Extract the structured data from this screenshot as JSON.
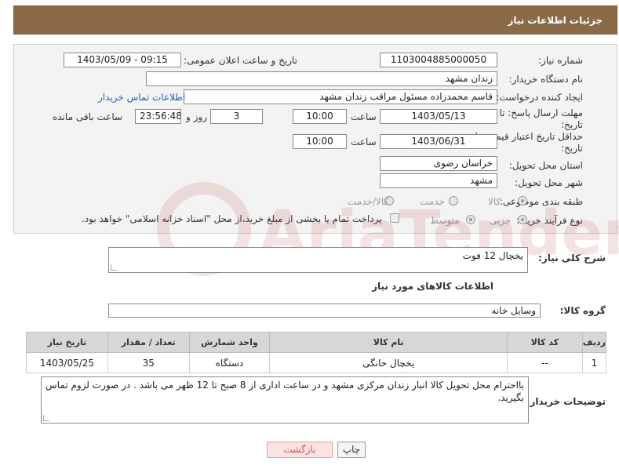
{
  "header": {
    "title": "جزئیات اطلاعات نیاز"
  },
  "form": {
    "need_number": {
      "label": "شماره نیاز:",
      "value": "1103004885000050"
    },
    "announce": {
      "label": "تاریخ و ساعت اعلان عمومی:",
      "value": "1403/05/09 - 09:15"
    },
    "buyer": {
      "label": "نام دستگاه خریدار:",
      "value": "زندان مشهد"
    },
    "creator": {
      "label": "ایجاد کننده درخواست:",
      "value": "قاسم محمدزاده مسئول مراقب زندان مشهد",
      "contact_link": "اطلاعات تماس خریدار"
    },
    "reply_deadline": {
      "label_line1": "مهلت ارسال پاسخ: تا",
      "label_line2": "تاریخ:",
      "date": "1403/05/13",
      "time_label": "ساعت",
      "time": "10:00",
      "days": "3",
      "days_label": "روز و",
      "remaining": "23:56:48",
      "remaining_label": "ساعت باقی مانده"
    },
    "price_deadline": {
      "label_line1": "حداقل تاریخ اعتبار قیمت: تا",
      "label_line2": "تاریخ:",
      "date": "1403/06/31",
      "time_label": "ساعت",
      "time": "10:00"
    },
    "province": {
      "label": "استان محل تحویل:",
      "value": "خراسان رضوی"
    },
    "city": {
      "label": "شهر محل تحویل:",
      "value": "مشهد"
    },
    "category": {
      "label": "طبقه بندی موضوعی:",
      "options": [
        "کالا",
        "خدمت",
        "کالا/خدمت"
      ],
      "selected": "کالا"
    },
    "process": {
      "label": "نوع فرآیند خرید :",
      "options": [
        "جزیی",
        "متوسط"
      ],
      "selected": "جزیی",
      "checkbox_text": "پرداخت تمام یا بخشی از مبلغ خرید،از محل \"اسناد خزانه اسلامی\" خواهد بود."
    }
  },
  "description": {
    "label": "شرح کلی نیاز:",
    "value": "یخچال 12 فوت"
  },
  "goods_section": {
    "title": "اطلاعات کالاهای مورد نیاز"
  },
  "goods_group": {
    "label": "گروه کالا:",
    "value": "وسایل خانه"
  },
  "table": {
    "headers": [
      "ردیف",
      "کد کالا",
      "نام کالا",
      "واحد شمارش",
      "تعداد / مقدار",
      "تاریخ نیاز"
    ],
    "rows": [
      [
        "1",
        "--",
        "یخچال خانگی",
        "دستگاه",
        "35",
        "1403/05/25"
      ]
    ]
  },
  "buyer_notes": {
    "label": "توضیحات خریدار:",
    "value": "بااحترام محل تحویل کالا انبار زندان مرکزی مشهد و در ساعت اداری از 8 صبح تا 12 ظهر می باشد . در صورت لزوم تماس بگیرید."
  },
  "buttons": {
    "print": "چاپ",
    "back": "بازگشت"
  },
  "watermark": {
    "text": "AriaTender.neT"
  }
}
